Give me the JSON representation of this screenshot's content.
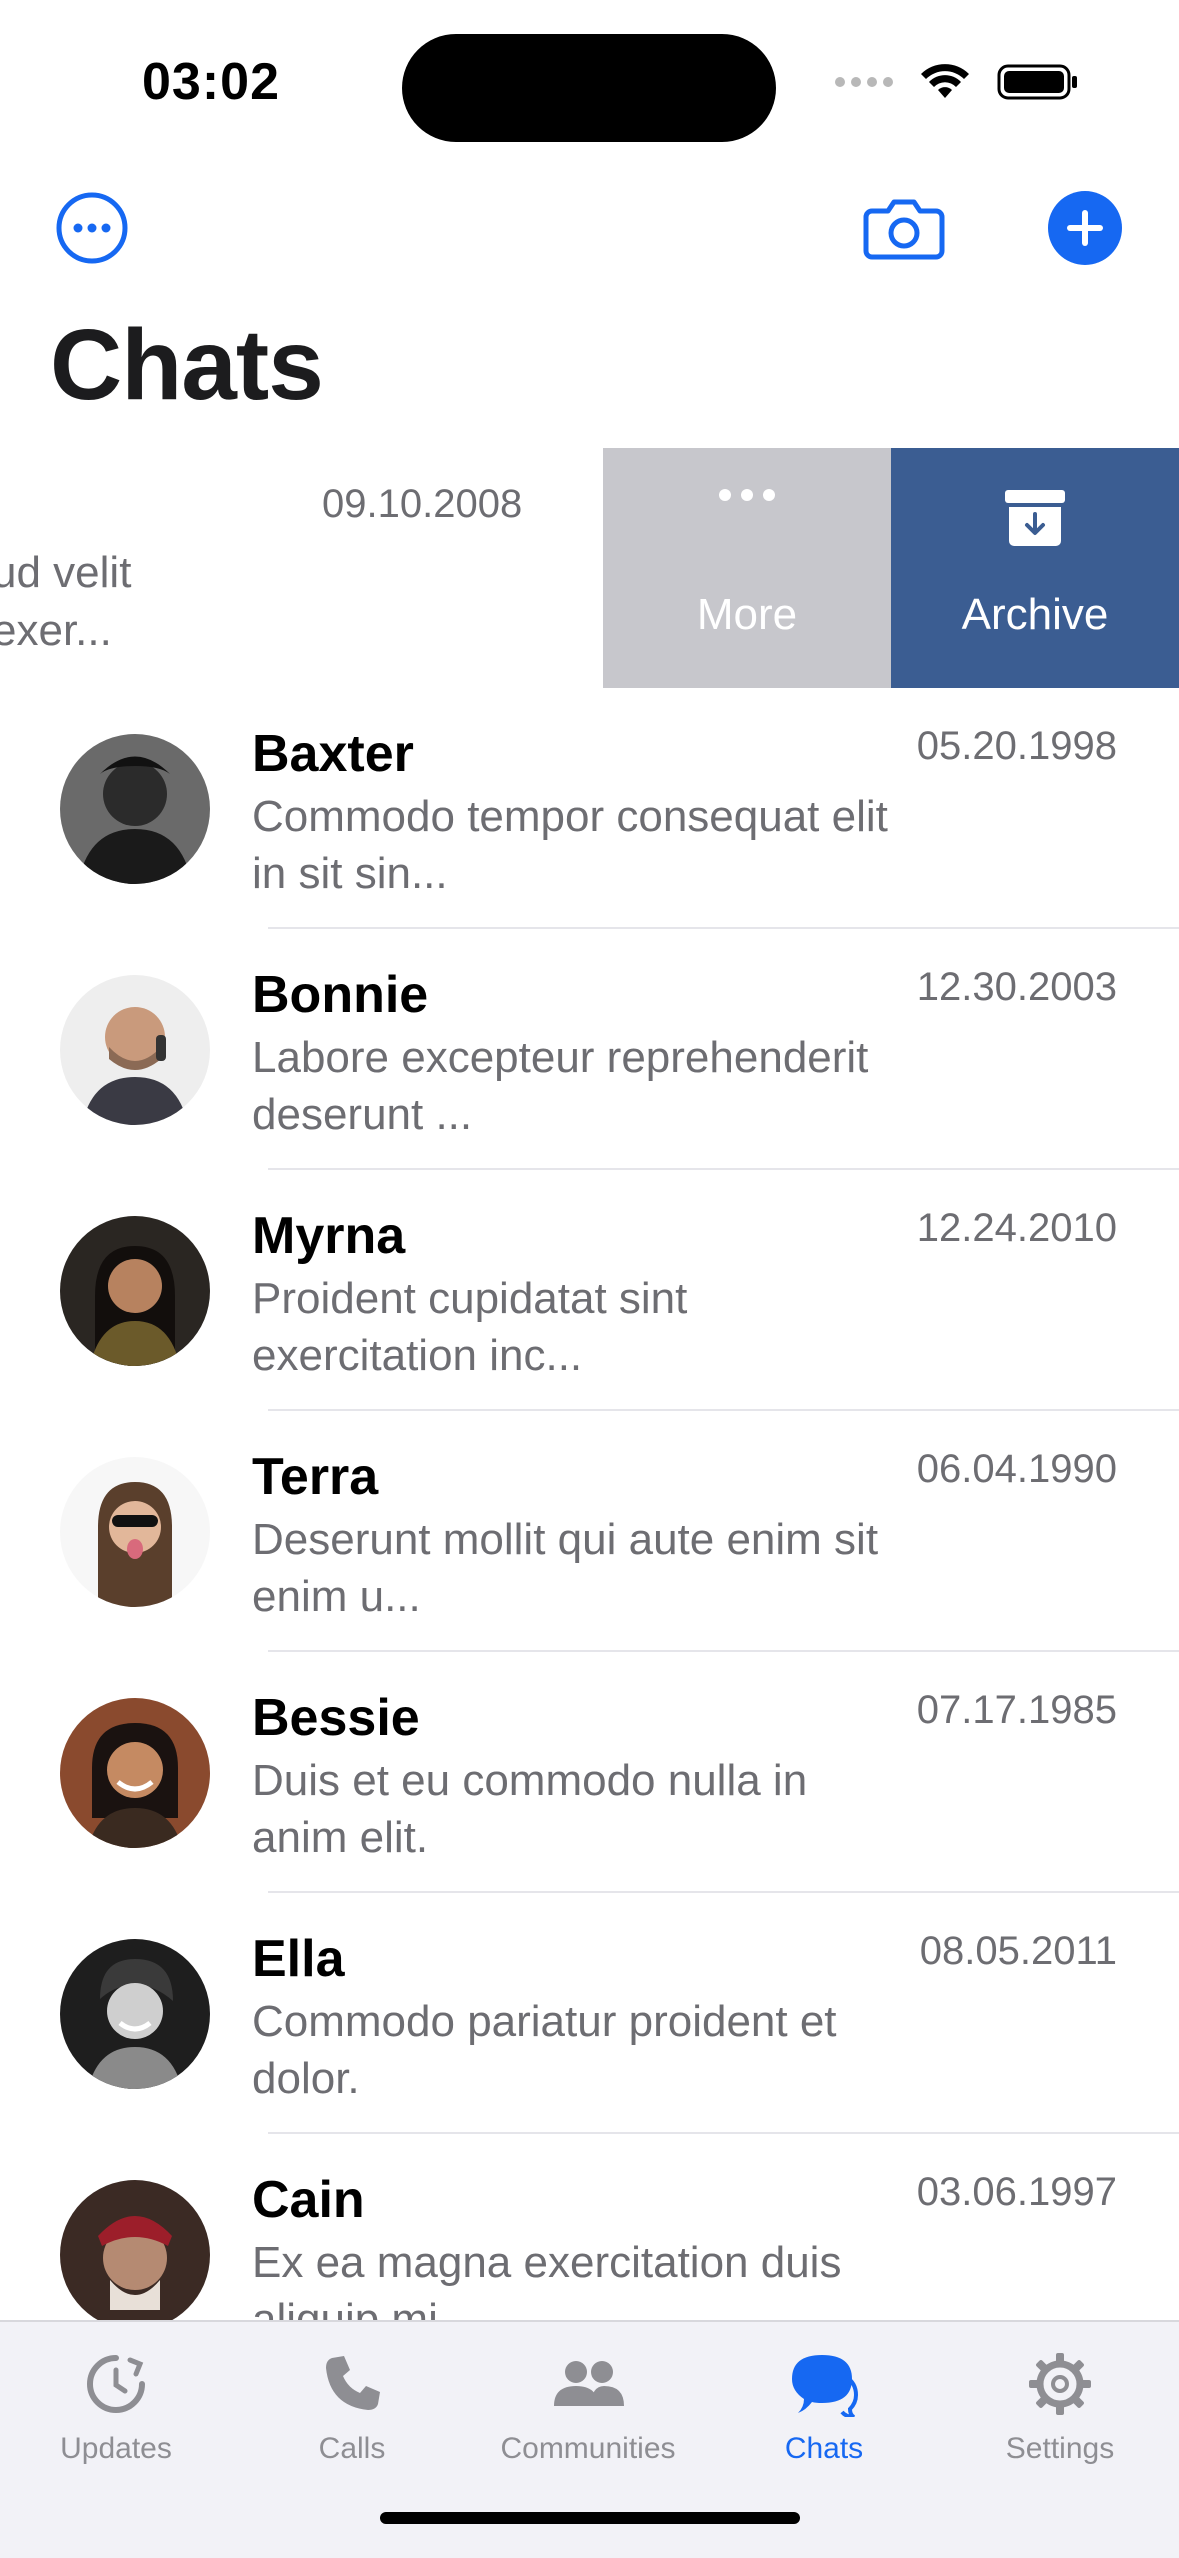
{
  "status_bar": {
    "time": "03:02"
  },
  "header": {
    "title": "Chats",
    "menu_icon": "ellipsis-circle-icon",
    "camera_icon": "camera-icon",
    "add_icon": "plus-circle-fill-icon"
  },
  "swiped_chat": {
    "date": "09.10.2008",
    "preview_line1": "ud velit",
    "preview_line2": "exer...",
    "actions": [
      {
        "label": "More",
        "icon": "ellipsis-icon",
        "color": "#c7c7cc"
      },
      {
        "label": "Archive",
        "icon": "archive-box-icon",
        "color": "#3b5d92"
      }
    ]
  },
  "chats": [
    {
      "name": "Baxter",
      "preview": "Commodo tempor consequat elit in sit sin...",
      "date": "05.20.1998"
    },
    {
      "name": "Bonnie",
      "preview": "Labore excepteur reprehenderit deserunt ...",
      "date": "12.30.2003"
    },
    {
      "name": "Myrna",
      "preview": "Proident cupidatat sint exercitation inc...",
      "date": "12.24.2010"
    },
    {
      "name": "Terra",
      "preview": "Deserunt mollit qui aute enim sit enim u...",
      "date": "06.04.1990"
    },
    {
      "name": "Bessie",
      "preview": "Duis et eu commodo nulla in anim elit.",
      "date": "07.17.1985"
    },
    {
      "name": "Ella",
      "preview": "Commodo pariatur proident et dolor.",
      "date": "08.05.2011"
    },
    {
      "name": "Cain",
      "preview": "Ex ea magna exercitation duis aliquip mi...",
      "date": "03.06.1997"
    }
  ],
  "tabs": [
    {
      "label": "Updates",
      "icon": "updates-icon",
      "active": false
    },
    {
      "label": "Calls",
      "icon": "phone-icon",
      "active": false
    },
    {
      "label": "Communities",
      "icon": "communities-icon",
      "active": false
    },
    {
      "label": "Chats",
      "icon": "chat-bubbles-icon",
      "active": true
    },
    {
      "label": "Settings",
      "icon": "gear-icon",
      "active": false
    }
  ],
  "colors": {
    "accent": "#1668f2",
    "archive": "#3b5d92",
    "more": "#c7c7cc",
    "secondary_text": "#6d6d72"
  }
}
